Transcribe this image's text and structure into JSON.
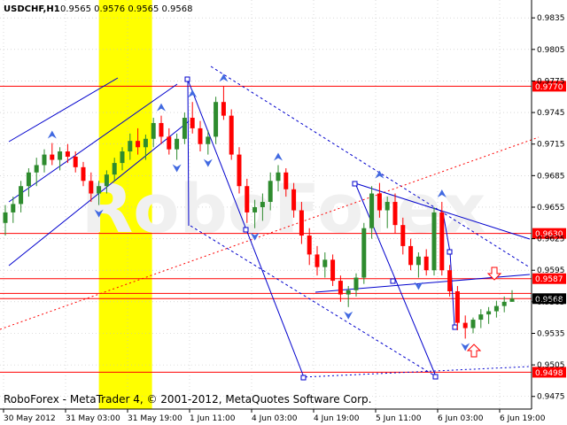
{
  "header": {
    "symbol": "USDCHF,H1",
    "ohlc": "0.9565 0.9576 0.9565 0.9568"
  },
  "footer": {
    "credit": "RoboForex - MetaTrader 4, © 2001-2012, MetaQuotes Software Corp."
  },
  "watermark": "RoboForex",
  "colors": {
    "background": "#ffffff",
    "grid": "#c0c0c0",
    "bull": "#2e8b2e",
    "bear": "#ff0000",
    "level_line": "#ff0000",
    "trend_line": "#0000cd",
    "highlight": "#ffff00",
    "price_box": "#ff0000",
    "current_box": "#000000",
    "arrow": "#4169e1",
    "signal_arrow": "#ff0000"
  },
  "chart_data": {
    "type": "candlestick",
    "ylim": [
      0.9463,
      0.9852
    ],
    "y_ticks": [
      "0.9835",
      "0.9805",
      "0.9775",
      "0.9745",
      "0.9715",
      "0.9685",
      "0.9655",
      "0.9625",
      "0.9595",
      "0.9565",
      "0.9535",
      "0.9505",
      "0.9475"
    ],
    "x_labels": [
      "30 May 2012",
      "31 May 03:00",
      "31 May 19:00",
      "1 Jun 11:00",
      "4 Jun 03:00",
      "4 Jun 19:00",
      "5 Jun 11:00",
      "6 Jun 03:00",
      "6 Jun 19:00"
    ],
    "levels": [
      {
        "value": 0.977,
        "label": "0.9770",
        "current": false
      },
      {
        "value": 0.963,
        "label": "0.9630",
        "current": false
      },
      {
        "value": 0.9587,
        "label": "0.9587",
        "current": false
      },
      {
        "value": 0.9573,
        "label": "",
        "current": false
      },
      {
        "value": 0.9568,
        "label": "0.9568",
        "current": true
      },
      {
        "value": 0.9498,
        "label": "0.9498",
        "current": false
      }
    ],
    "highlight_range": [
      0.186,
      0.286
    ],
    "series": [
      {
        "values": [
          [
            0.964,
            0.9657,
            0.9628,
            0.965
          ],
          [
            0.965,
            0.9665,
            0.964,
            0.9658
          ],
          [
            0.9658,
            0.968,
            0.965,
            0.9675
          ],
          [
            0.9675,
            0.9692,
            0.9665,
            0.9688
          ],
          [
            0.9688,
            0.9702,
            0.9675,
            0.9695
          ],
          [
            0.9695,
            0.971,
            0.9688,
            0.9705
          ],
          [
            0.9705,
            0.9716,
            0.9695,
            0.97
          ],
          [
            0.97,
            0.9712,
            0.969,
            0.9708
          ],
          [
            0.9708,
            0.9715,
            0.9697,
            0.9703
          ],
          [
            0.9703,
            0.9708,
            0.9688,
            0.9693
          ],
          [
            0.9693,
            0.9698,
            0.9675,
            0.968
          ],
          [
            0.968,
            0.9688,
            0.966,
            0.9668
          ],
          [
            0.9668,
            0.968,
            0.9657,
            0.9675
          ],
          [
            0.9675,
            0.969,
            0.9668,
            0.9686
          ],
          [
            0.9686,
            0.9702,
            0.968,
            0.9697
          ],
          [
            0.9697,
            0.9712,
            0.969,
            0.9708
          ],
          [
            0.9708,
            0.9725,
            0.97,
            0.9718
          ],
          [
            0.9718,
            0.973,
            0.9705,
            0.9712
          ],
          [
            0.9712,
            0.9724,
            0.97,
            0.972
          ],
          [
            0.972,
            0.974,
            0.9712,
            0.9735
          ],
          [
            0.9735,
            0.9742,
            0.9715,
            0.9722
          ],
          [
            0.9722,
            0.973,
            0.9705,
            0.971
          ],
          [
            0.971,
            0.9725,
            0.97,
            0.972
          ],
          [
            0.972,
            0.9745,
            0.9715,
            0.974
          ],
          [
            0.974,
            0.9755,
            0.9725,
            0.973
          ],
          [
            0.973,
            0.9737,
            0.9708,
            0.9715
          ],
          [
            0.9715,
            0.9728,
            0.9705,
            0.9722
          ],
          [
            0.9722,
            0.976,
            0.9715,
            0.9755
          ],
          [
            0.9755,
            0.977,
            0.9738,
            0.9742
          ],
          [
            0.9742,
            0.9748,
            0.97,
            0.9705
          ],
          [
            0.9705,
            0.9712,
            0.9668,
            0.9675
          ],
          [
            0.9675,
            0.9682,
            0.964,
            0.965
          ],
          [
            0.965,
            0.9662,
            0.9635,
            0.9655
          ],
          [
            0.9655,
            0.9668,
            0.9642,
            0.966
          ],
          [
            0.966,
            0.9688,
            0.9652,
            0.968
          ],
          [
            0.968,
            0.9695,
            0.967,
            0.9688
          ],
          [
            0.9688,
            0.9692,
            0.9665,
            0.9672
          ],
          [
            0.9672,
            0.9678,
            0.9645,
            0.9652
          ],
          [
            0.9652,
            0.966,
            0.962,
            0.9628
          ],
          [
            0.9628,
            0.9635,
            0.96,
            0.961
          ],
          [
            0.961,
            0.9618,
            0.959,
            0.9598
          ],
          [
            0.9598,
            0.9612,
            0.9588,
            0.9605
          ],
          [
            0.9605,
            0.961,
            0.958,
            0.9585
          ],
          [
            0.9585,
            0.959,
            0.9565,
            0.9572
          ],
          [
            0.9572,
            0.958,
            0.956,
            0.9576
          ],
          [
            0.9576,
            0.9592,
            0.957,
            0.9588
          ],
          [
            0.9588,
            0.964,
            0.9582,
            0.9635
          ],
          [
            0.9635,
            0.9675,
            0.9625,
            0.9668
          ],
          [
            0.9668,
            0.9678,
            0.9645,
            0.9652
          ],
          [
            0.9652,
            0.9665,
            0.9635,
            0.966
          ],
          [
            0.966,
            0.9668,
            0.963,
            0.9638
          ],
          [
            0.9638,
            0.9645,
            0.961,
            0.9618
          ],
          [
            0.9618,
            0.9625,
            0.9595,
            0.96
          ],
          [
            0.96,
            0.9612,
            0.9588,
            0.9608
          ],
          [
            0.9608,
            0.9615,
            0.959,
            0.9595
          ],
          [
            0.9595,
            0.9655,
            0.959,
            0.965
          ],
          [
            0.965,
            0.966,
            0.959,
            0.9595
          ],
          [
            0.9595,
            0.96,
            0.957,
            0.9575
          ],
          [
            0.9575,
            0.958,
            0.9538,
            0.9545
          ],
          [
            0.9545,
            0.9552,
            0.953,
            0.954
          ],
          [
            0.954,
            0.955,
            0.9535,
            0.9548
          ],
          [
            0.9548,
            0.9558,
            0.954,
            0.9553
          ],
          [
            0.9553,
            0.956,
            0.9544,
            0.9556
          ],
          [
            0.9556,
            0.9566,
            0.955,
            0.9561
          ],
          [
            0.9561,
            0.957,
            0.9555,
            0.9565
          ],
          [
            0.9565,
            0.9576,
            0.9565,
            0.9568
          ]
        ]
      }
    ]
  }
}
